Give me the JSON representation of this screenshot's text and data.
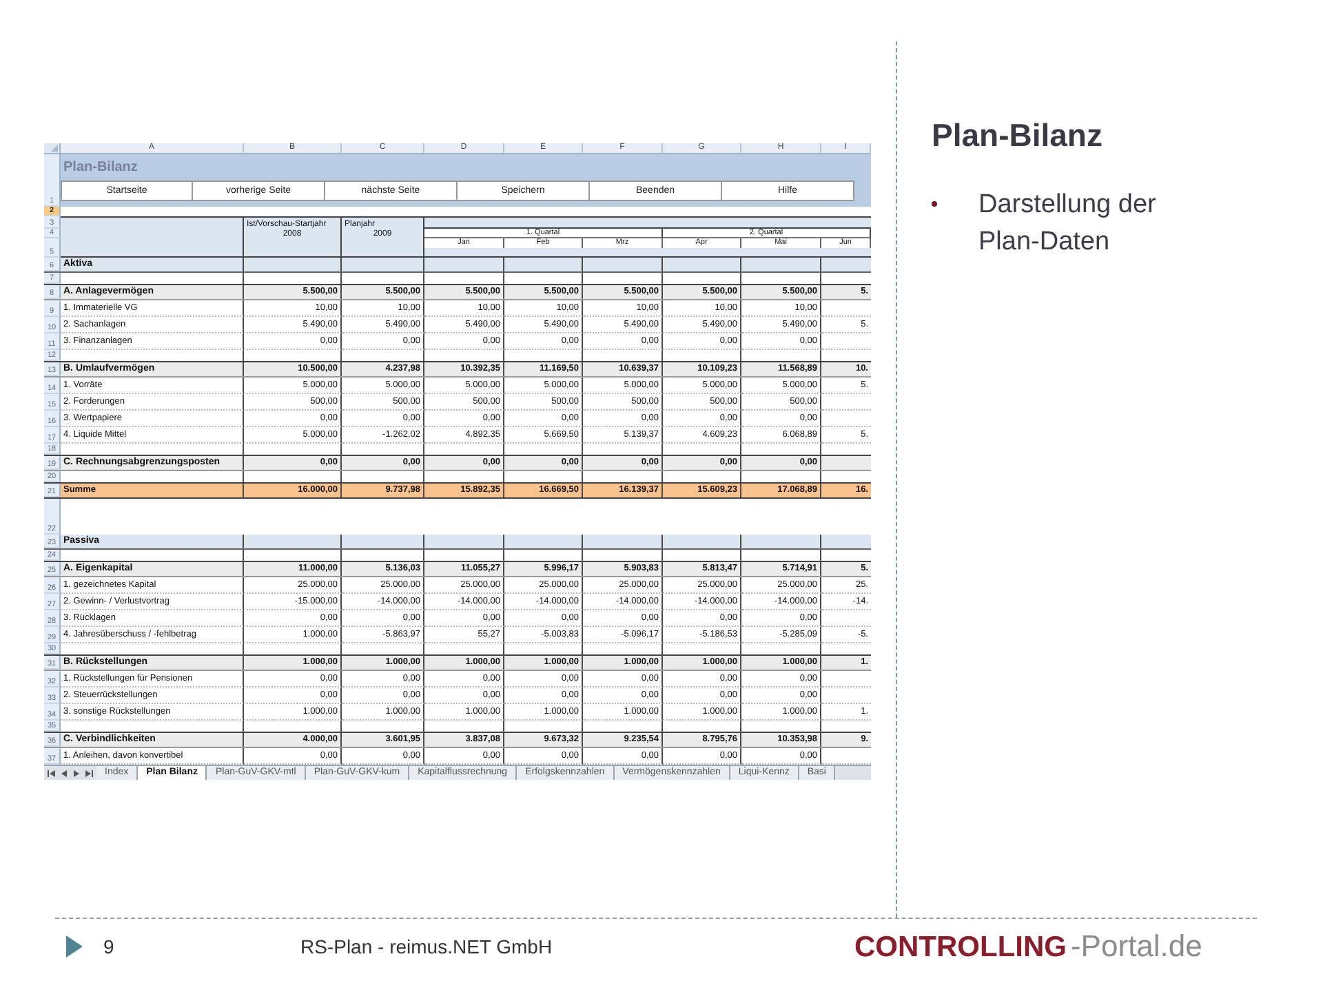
{
  "sheet": {
    "columns": [
      "A",
      "B",
      "C",
      "D",
      "E",
      "F",
      "G",
      "H",
      "I"
    ],
    "rows": [
      {
        "kind": "title",
        "number": "1",
        "selected": false,
        "title": "Plan-Bilanz",
        "buttons": [
          "Startseite",
          "vorherige Seite",
          "nächste Seite",
          "Speichern",
          "Beenden",
          "Hilfe"
        ]
      },
      {
        "kind": "blank",
        "number": "2",
        "selected": true
      },
      {
        "kind": "header",
        "numbers": [
          "3",
          "4",
          "5"
        ],
        "selected": false,
        "columns": [
          {
            "title": "Ist/Vorschau-Startjahr",
            "year": "2008"
          },
          {
            "title": "Planjahr",
            "year": "2009"
          }
        ],
        "quarters": [
          "1. Quartal",
          "2. Quartal"
        ],
        "months": [
          "Jan",
          "Feb",
          "Mrz",
          "Apr",
          "Mai",
          "Jun"
        ]
      },
      {
        "kind": "section",
        "number": "6",
        "selected": false,
        "label": "Aktiva"
      },
      {
        "kind": "spacer",
        "number": "7",
        "selected": false
      },
      {
        "kind": "group",
        "number": "8",
        "selected": false,
        "label": "A. Anlagevermögen",
        "values": [
          "5.500,00",
          "5.500,00",
          "5.500,00",
          "5.500,00",
          "5.500,00",
          "5.500,00",
          "5.500,00",
          "5."
        ]
      },
      {
        "kind": "item",
        "number": "9",
        "selected": false,
        "label": "1. Immaterielle VG",
        "values": [
          "10,00",
          "10,00",
          "10,00",
          "10,00",
          "10,00",
          "10,00",
          "10,00"
        ]
      },
      {
        "kind": "item",
        "number": "10",
        "selected": false,
        "label": "2. Sachanlagen",
        "values": [
          "5.490,00",
          "5.490,00",
          "5.490,00",
          "5.490,00",
          "5.490,00",
          "5.490,00",
          "5.490,00",
          "5."
        ]
      },
      {
        "kind": "item",
        "number": "11",
        "selected": false,
        "label": "3. Finanzanlagen",
        "values": [
          "0,00",
          "0,00",
          "0,00",
          "0,00",
          "0,00",
          "0,00",
          "0,00"
        ]
      },
      {
        "kind": "spacer",
        "number": "12",
        "selected": false
      },
      {
        "kind": "group",
        "number": "13",
        "selected": false,
        "label": "B. Umlaufvermögen",
        "values": [
          "10.500,00",
          "4.237,98",
          "10.392,35",
          "11.169,50",
          "10.639,37",
          "10.109,23",
          "11.568,89",
          "10."
        ]
      },
      {
        "kind": "item",
        "number": "14",
        "selected": false,
        "label": "1. Vorräte",
        "values": [
          "5.000,00",
          "5.000,00",
          "5.000,00",
          "5.000,00",
          "5.000,00",
          "5.000,00",
          "5.000,00",
          "5."
        ]
      },
      {
        "kind": "item",
        "number": "15",
        "selected": false,
        "label": "2. Forderungen",
        "values": [
          "500,00",
          "500,00",
          "500,00",
          "500,00",
          "500,00",
          "500,00",
          "500,00"
        ]
      },
      {
        "kind": "item",
        "number": "16",
        "selected": false,
        "label": "3. Wertpapiere",
        "values": [
          "0,00",
          "0,00",
          "0,00",
          "0,00",
          "0,00",
          "0,00",
          "0,00"
        ]
      },
      {
        "kind": "item",
        "number": "17",
        "selected": false,
        "label": "4. Liquide Mittel",
        "values": [
          "5.000,00",
          "-1.262,02",
          "4.892,35",
          "5.669,50",
          "5.139,37",
          "4.609,23",
          "6.068,89",
          "5."
        ]
      },
      {
        "kind": "spacer",
        "number": "18",
        "selected": false
      },
      {
        "kind": "group",
        "number": "19",
        "selected": false,
        "label": "C. Rechnungsabgrenzungsposten",
        "values": [
          "0,00",
          "0,00",
          "0,00",
          "0,00",
          "0,00",
          "0,00",
          "0,00"
        ]
      },
      {
        "kind": "spacer",
        "number": "20",
        "selected": false
      },
      {
        "kind": "total",
        "number": "21",
        "selected": false,
        "label": "Summe",
        "values": [
          "16.000,00",
          "9.737,98",
          "15.892,35",
          "16.669,50",
          "16.139,37",
          "15.609,23",
          "17.068,89",
          "16."
        ]
      },
      {
        "kind": "gap",
        "number": "22",
        "selected": false
      },
      {
        "kind": "section",
        "number": "23",
        "selected": false,
        "label": "Passiva"
      },
      {
        "kind": "spacer",
        "number": "24",
        "selected": false
      },
      {
        "kind": "group",
        "number": "25",
        "selected": false,
        "label": "A. Eigenkapital",
        "values": [
          "11.000,00",
          "5.136,03",
          "11.055,27",
          "5.996,17",
          "5.903,83",
          "5.813,47",
          "5.714,91",
          "5."
        ]
      },
      {
        "kind": "item",
        "number": "26",
        "selected": false,
        "label": "1. gezeichnetes Kapital",
        "values": [
          "25.000,00",
          "25.000,00",
          "25.000,00",
          "25.000,00",
          "25.000,00",
          "25.000,00",
          "25.000,00",
          "25."
        ]
      },
      {
        "kind": "item",
        "number": "27",
        "selected": false,
        "label": "2. Gewinn- / Verlustvortrag",
        "values": [
          "-15.000,00",
          "-14.000,00",
          "-14.000,00",
          "-14.000,00",
          "-14.000,00",
          "-14.000,00",
          "-14.000,00",
          "-14."
        ]
      },
      {
        "kind": "item",
        "number": "28",
        "selected": false,
        "label": "3. Rücklagen",
        "values": [
          "0,00",
          "0,00",
          "0,00",
          "0,00",
          "0,00",
          "0,00",
          "0,00"
        ]
      },
      {
        "kind": "item",
        "number": "29",
        "selected": false,
        "label": "4. Jahresüberschuss / -fehlbetrag",
        "values": [
          "1.000,00",
          "-5.863,97",
          "55,27",
          "-5.003,83",
          "-5.096,17",
          "-5.186,53",
          "-5.285,09",
          "-5."
        ]
      },
      {
        "kind": "spacer",
        "number": "30",
        "selected": false
      },
      {
        "kind": "group",
        "number": "31",
        "selected": false,
        "label": "B. Rückstellungen",
        "values": [
          "1.000,00",
          "1.000,00",
          "1.000,00",
          "1.000,00",
          "1.000,00",
          "1.000,00",
          "1.000,00",
          "1."
        ]
      },
      {
        "kind": "item",
        "number": "32",
        "selected": false,
        "label": "1. Rückstellungen für Pensionen",
        "values": [
          "0,00",
          "0,00",
          "0,00",
          "0,00",
          "0,00",
          "0,00",
          "0,00"
        ]
      },
      {
        "kind": "item",
        "number": "33",
        "selected": false,
        "label": "2. Steuerrückstellungen",
        "values": [
          "0,00",
          "0,00",
          "0,00",
          "0,00",
          "0,00",
          "0,00",
          "0,00"
        ]
      },
      {
        "kind": "item",
        "number": "34",
        "selected": false,
        "label": "3. sonstige Rückstellungen",
        "values": [
          "1.000,00",
          "1.000,00",
          "1.000,00",
          "1.000,00",
          "1.000,00",
          "1.000,00",
          "1.000,00",
          "1."
        ]
      },
      {
        "kind": "spacer",
        "number": "35",
        "selected": false
      },
      {
        "kind": "group",
        "number": "36",
        "selected": false,
        "label": "C. Verbindlichkeiten",
        "values": [
          "4.000,00",
          "3.601,95",
          "3.837,08",
          "9.673,32",
          "9.235,54",
          "8.795,76",
          "10.353,98",
          "9."
        ]
      },
      {
        "kind": "item",
        "number": "37",
        "selected": false,
        "label": "1. Anleihen, davon konvertibel",
        "values": [
          "0,00",
          "0,00",
          "0,00",
          "0,00",
          "0,00",
          "0,00",
          "0,00"
        ]
      }
    ],
    "tabs": [
      {
        "label": "Index",
        "selected": false
      },
      {
        "label": "Plan Bilanz",
        "selected": true
      },
      {
        "label": "Plan-GuV-GKV-mtl",
        "selected": false
      },
      {
        "label": "Plan-GuV-GKV-kum",
        "selected": false
      },
      {
        "label": "Kapitalflussrechnung",
        "selected": false
      },
      {
        "label": "Erfolgskennzahlen",
        "selected": false
      },
      {
        "label": "Vermögenskennzahlen",
        "selected": false
      },
      {
        "label": "Liqui-Kennz",
        "selected": false
      },
      {
        "label": "Basi",
        "selected": false
      }
    ]
  },
  "slide": {
    "title": "Plan-Bilanz",
    "bullets": [
      "Darstellung der Plan-Daten"
    ]
  },
  "footer": {
    "page": "9",
    "text": "RS-Plan - reimus.NET GmbH",
    "logo": {
      "brand": "CONTROLLING",
      "suffix": "-Portal.de"
    }
  }
}
